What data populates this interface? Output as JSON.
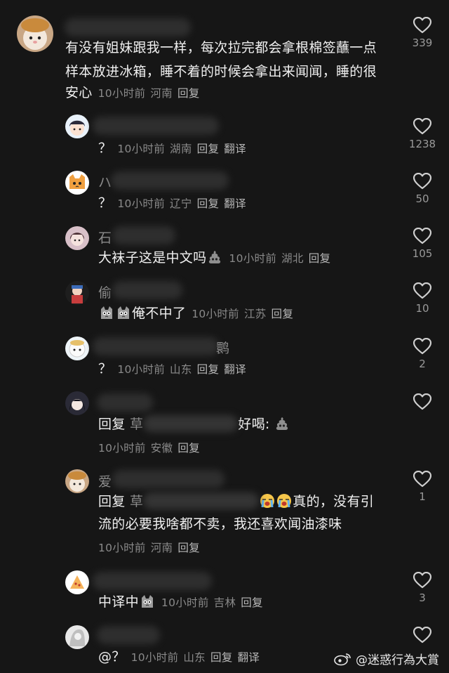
{
  "comments": [
    {
      "text_lines": [
        "有没有姐妹跟我一样，每次拉完都会拿根棉签蘸一点",
        "样本放进冰箱，睡不着的时候会拿出来闻闻，睡的很",
        "安心"
      ],
      "time": "10小时前",
      "region": "河南",
      "reply": "回复",
      "likes": "339"
    },
    {
      "text": "？",
      "time": "10小时前",
      "region": "湖南",
      "reply": "回复",
      "translate": "翻译",
      "likes": "1238"
    },
    {
      "name_char": "ハ",
      "text": "？",
      "time": "10小时前",
      "region": "辽宁",
      "reply": "回复",
      "translate": "翻译",
      "likes": "50"
    },
    {
      "name_char": "石",
      "text": "大袜子这是中文吗",
      "time": "10小时前",
      "region": "湖北",
      "reply": "回复",
      "likes": "105"
    },
    {
      "name_char": "偷",
      "text": "俺不中了",
      "time": "10小时前",
      "region": "江苏",
      "reply": "回复",
      "likes": "10"
    },
    {
      "name_char": "鹮",
      "text": "？",
      "time": "10小时前",
      "region": "山东",
      "reply": "回复",
      "translate": "翻译",
      "likes": "2"
    },
    {
      "text_prefix": "回复",
      "text_pre_char": "草",
      "text_post": "好喝:",
      "time": "10小时前",
      "region": "安徽",
      "reply": "回复",
      "likes": ""
    },
    {
      "name_char": "爱",
      "text_prefix": "回复",
      "text_pre_char": "草",
      "text_post": "真的，没有引",
      "text_line2": "流的必要我啥都不卖，我还喜欢闻油漆味",
      "time": "10小时前",
      "region": "河南",
      "reply": "回复",
      "likes": "1"
    },
    {
      "text_a": "中译中",
      "time": "10小时前",
      "region": "吉林",
      "reply": "回复",
      "likes": "3"
    },
    {
      "text": "@？",
      "time": "10小时前",
      "region": "山东",
      "reply": "回复",
      "translate": "翻译",
      "likes": ""
    }
  ],
  "watermark": "@迷惑行為大賞",
  "icons": {
    "like": "heart-outline-icon",
    "weibo": "weibo-logo-icon"
  }
}
